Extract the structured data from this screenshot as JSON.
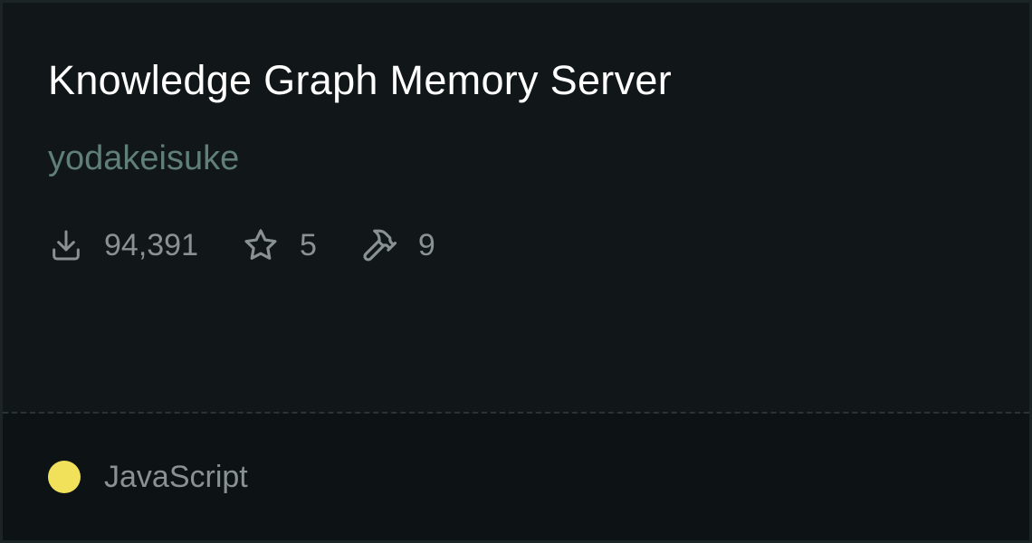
{
  "card": {
    "title": "Knowledge Graph Memory Server",
    "author": "yodakeisuke",
    "stats": {
      "downloads": "94,391",
      "stars": "5",
      "tools": "9"
    },
    "language": {
      "name": "JavaScript",
      "color": "#f1e05a"
    }
  },
  "colors": {
    "background": "#111719",
    "footer_background": "#0d1214",
    "title": "#ffffff",
    "author": "#5f7f78",
    "muted_text": "#8a9193",
    "icon": "#8a9193"
  },
  "icons": [
    "download-icon",
    "star-icon",
    "hammer-icon"
  ]
}
